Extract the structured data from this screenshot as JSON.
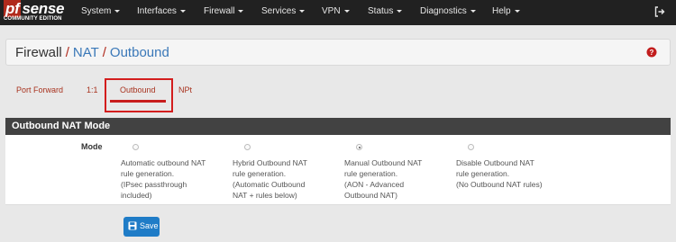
{
  "logo": {
    "brand_pf": "pf",
    "brand_sense": "sense",
    "edition": "COMMUNITY EDITION"
  },
  "nav": [
    {
      "label": "System"
    },
    {
      "label": "Interfaces"
    },
    {
      "label": "Firewall"
    },
    {
      "label": "Services"
    },
    {
      "label": "VPN"
    },
    {
      "label": "Status"
    },
    {
      "label": "Diagnostics"
    },
    {
      "label": "Help"
    }
  ],
  "breadcrumb": {
    "first": "Firewall",
    "separator": "/",
    "second": "NAT",
    "third": "Outbound"
  },
  "tabs": [
    {
      "label": "Port Forward"
    },
    {
      "label": "1:1"
    },
    {
      "label": "Outbound"
    },
    {
      "label": "NPt"
    }
  ],
  "active_tab": "Outbound",
  "panel": {
    "title": "Outbound NAT Mode",
    "mode_label": "Mode",
    "options": [
      {
        "lines": [
          "Automatic outbound NAT",
          "rule generation.",
          "(IPsec passthrough",
          "included)"
        ],
        "checked": false
      },
      {
        "lines": [
          "Hybrid Outbound NAT",
          "rule generation.",
          "(Automatic Outbound",
          "NAT + rules below)"
        ],
        "checked": false
      },
      {
        "lines": [
          "Manual Outbound NAT",
          "rule generation.",
          "(AON - Advanced",
          "Outbound NAT)"
        ],
        "checked": true
      },
      {
        "lines": [
          "Disable Outbound NAT",
          "rule generation.",
          "(No Outbound NAT rules)"
        ],
        "checked": false
      }
    ]
  },
  "save_button": {
    "label": "Save"
  },
  "colors": {
    "navbar": "#212121",
    "accent_red": "#b02a1c",
    "link_blue": "#3a78b8",
    "button_blue": "#1f7cc7",
    "highlight_red": "#d31d1d"
  },
  "icons": {
    "logout": "sign-out-icon",
    "help": "question-circle-icon",
    "save": "floppy-disk-icon"
  }
}
